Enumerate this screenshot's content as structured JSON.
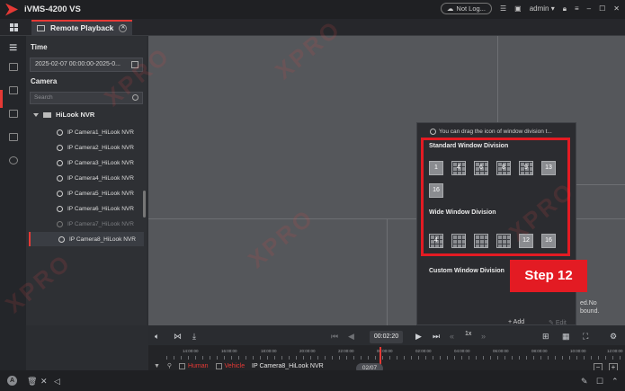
{
  "app": {
    "title": "iVMS-4200 VS"
  },
  "titlebar": {
    "cloud_label": "Not Log...",
    "user": "admin"
  },
  "tab": {
    "label": "Remote Playback"
  },
  "left": {
    "time_label": "Time",
    "date_range": "2025-02-07 00:00:00-2025-0...",
    "camera_label": "Camera",
    "search_placeholder": "Search",
    "nvr": "HiLook NVR",
    "cameras": [
      "IP Camera1_HiLook NVR",
      "IP Camera2_HiLook NVR",
      "IP Camera3_HiLook NVR",
      "IP Camera4_HiLook NVR",
      "IP Camera5_HiLook NVR",
      "IP Camera6_HiLook NVR",
      "IP Camera7_HiLook NVR",
      "IP Camera8_HiLook NVR"
    ]
  },
  "popup": {
    "hint": "You can drag the icon of window division t...",
    "standard_title": "Standard Window Division",
    "standard_numbers": [
      "1",
      "4",
      "6",
      "8",
      "9",
      "13",
      "16"
    ],
    "wide_title": "Wide Window Division",
    "wide_numbers": [
      "4",
      "",
      "",
      "",
      "12",
      "16"
    ],
    "custom_title": "Custom Window Division",
    "add_label": "+ Add",
    "edit_label": "Edit"
  },
  "step_label": "Step 12",
  "side_text": [
    "ed.No",
    "bound."
  ],
  "controls": {
    "time": "00:02:20",
    "speed": "1x"
  },
  "timeline": {
    "ticks": [
      "14:00:00",
      "16:00:00",
      "18:00:00",
      "20:00:00",
      "22:00:00",
      "00:00:00",
      "02:00:00",
      "04:00:00",
      "06:00:00",
      "08:00:00",
      "10:00:00",
      "12:00:00"
    ],
    "filter_human": "Human",
    "filter_vehicle": "Vehicle",
    "camera": "IP Camera8_HiLook NVR",
    "date_chip": "02/07"
  },
  "colors": {
    "accent": "#e53935",
    "highlight_frame": "#e31b23"
  },
  "watermark": "XPRO"
}
